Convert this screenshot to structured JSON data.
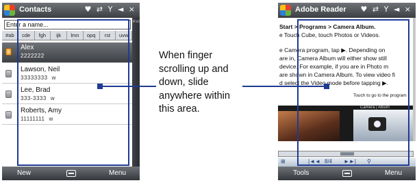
{
  "left_phone": {
    "title": "Contacts",
    "status_icons": "♥ ⇄ Y ◄ ×",
    "name_placeholder": "Enter a name...",
    "letter_tabs": [
      "#ab",
      "cde",
      "fgh",
      "ijk",
      "lmn",
      "opq",
      "rst",
      "uvw"
    ],
    "contacts": [
      {
        "name": "Alex",
        "phone": "2222222",
        "type": ""
      },
      {
        "name": "Lawson, Neil",
        "phone": "33333333",
        "type": "w"
      },
      {
        "name": "Lee, Brad",
        "phone": "333-3333",
        "type": "w"
      },
      {
        "name": "Roberts, Amy",
        "phone": "11111111",
        "type": "w"
      }
    ],
    "alphabet": "#abcdefghijklmnopqrstuvwxyz",
    "softkey_left": "New",
    "softkey_right": "Menu"
  },
  "right_phone": {
    "title": "Adobe Reader",
    "status_icons": "♥ ⇄ Y ◄ ×",
    "doc_lines": [
      "Start > Programs > Camera Album.",
      "e Touch Cube, touch Photos or Videos.",
      "",
      "e Camera program, tap ▶. Depending on",
      "are in, Camera Album will either show still",
      "device. For example, if you are in Photo m",
      "are shown in Camera Album. To view video fi",
      "d select the Video mode before tapping ▶."
    ],
    "side_note": "Touch to go to the program",
    "photo_caption": "Camera | Album",
    "page_indicator": "8/4",
    "softkey_left": "Tools",
    "softkey_right": "Menu"
  },
  "callout": {
    "text": "When finger scrolling up and down, slide anywhere within this area."
  },
  "colors": {
    "highlight": "#1f3a93"
  }
}
